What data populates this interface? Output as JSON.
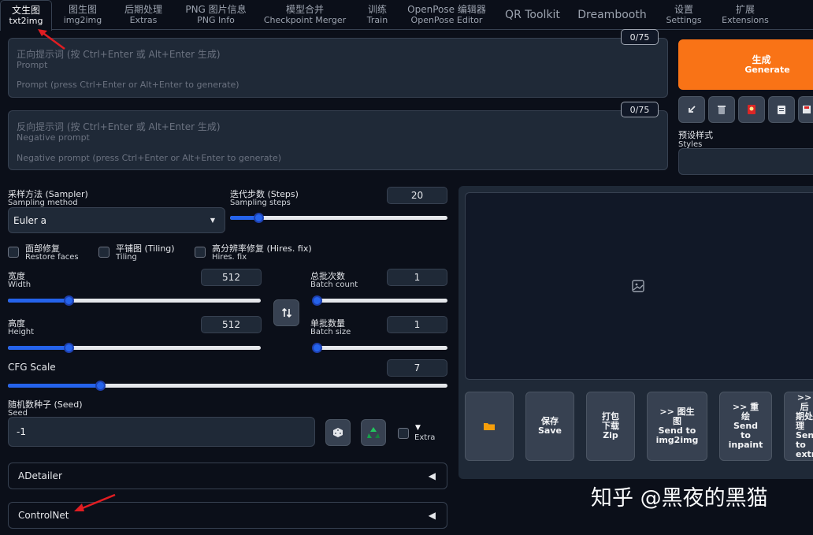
{
  "tabs": [
    {
      "zh": "文生图",
      "en": "txt2img",
      "active": true
    },
    {
      "zh": "图生图",
      "en": "img2img"
    },
    {
      "zh": "后期处理",
      "en": "Extras"
    },
    {
      "zh": "PNG 图片信息",
      "en": "PNG Info"
    },
    {
      "zh": "模型合并",
      "en": "Checkpoint Merger"
    },
    {
      "zh": "训练",
      "en": "Train"
    },
    {
      "zh": "OpenPose 编辑器",
      "en": "OpenPose Editor"
    },
    {
      "zh": "QR Toolkit",
      "en": ""
    },
    {
      "zh": "Dreambooth",
      "en": ""
    },
    {
      "zh": "设置",
      "en": "Settings"
    },
    {
      "zh": "扩展",
      "en": "Extensions"
    }
  ],
  "prompt": {
    "counter": "0/75",
    "placeholder_zh": "正向提示词 (按 Ctrl+Enter 或 Alt+Enter 生成)",
    "placeholder_en_label": "Prompt",
    "placeholder_en": "Prompt (press Ctrl+Enter or Alt+Enter to generate)"
  },
  "negative_prompt": {
    "counter": "0/75",
    "placeholder_zh": "反向提示词 (按 Ctrl+Enter 或 Alt+Enter 生成)",
    "placeholder_en_label": "Negative prompt",
    "placeholder_en": "Negative prompt (press Ctrl+Enter or Alt+Enter to generate)"
  },
  "generate": {
    "zh": "生成",
    "en": "Generate"
  },
  "tool_icons": [
    "arrow-bottom-left-icon",
    "trash-icon",
    "red-card-icon",
    "clipboard-icon",
    "save-icon"
  ],
  "styles": {
    "zh": "预设样式",
    "en": "Styles"
  },
  "sampler": {
    "zh": "采样方法 (Sampler)",
    "en": "Sampling method",
    "value": "Euler a"
  },
  "steps": {
    "zh": "迭代步数 (Steps)",
    "en": "Sampling steps",
    "value": "20",
    "fraction": 0.13
  },
  "checkboxes": {
    "restore_faces": {
      "zh": "面部修复",
      "en": "Restore faces"
    },
    "tiling": {
      "zh": "平铺图 (Tiling)",
      "en": "Tiling"
    },
    "hires_fix": {
      "zh": "高分辨率修复 (Hires. fix)",
      "en": "Hires. fix"
    }
  },
  "width": {
    "zh": "宽度",
    "en": "Width",
    "value": "512",
    "fraction": 0.24
  },
  "height": {
    "zh": "高度",
    "en": "Height",
    "value": "512",
    "fraction": 0.24
  },
  "batch_count": {
    "zh": "总批次数",
    "en": "Batch count",
    "value": "1",
    "fraction": 0.0
  },
  "batch_size": {
    "zh": "单批数量",
    "en": "Batch size",
    "value": "1",
    "fraction": 0.0
  },
  "swap_icon": "swap-vertical-icon",
  "cfg": {
    "zh": "CFG Scale",
    "value": "7",
    "fraction": 0.21
  },
  "seed": {
    "zh": "随机数种子 (Seed)",
    "en": "Seed",
    "value": "-1"
  },
  "seed_icons": [
    "dice-icon",
    "recycle-icon"
  ],
  "extra": {
    "arrow": "▼",
    "label": "Extra"
  },
  "accordions": [
    {
      "label": "ADetailer",
      "arrow": "◀"
    },
    {
      "label": "ControlNet",
      "arrow": "◀"
    }
  ],
  "gallery_buttons": [
    {
      "lines": [
        "📁"
      ],
      "icon": "folder-icon"
    },
    {
      "lines": [
        "保存",
        "Save"
      ]
    },
    {
      "lines": [
        "打包",
        "下载",
        "Zip"
      ]
    },
    {
      "lines": [
        ">> 图生",
        "图",
        "Send to",
        "img2img"
      ]
    },
    {
      "lines": [
        ">> 重",
        "绘",
        "Send",
        "to",
        "inpaint"
      ]
    },
    {
      "lines": [
        ">> 后",
        "期处",
        "理",
        "Send",
        "to",
        "extras"
      ]
    }
  ],
  "watermark": "知乎 @黑夜的黑猫",
  "colors": {
    "generate": "#f97316",
    "accent": "#2563eb",
    "background": "#0b0f19",
    "annotation_arrow": "#e11d22"
  }
}
